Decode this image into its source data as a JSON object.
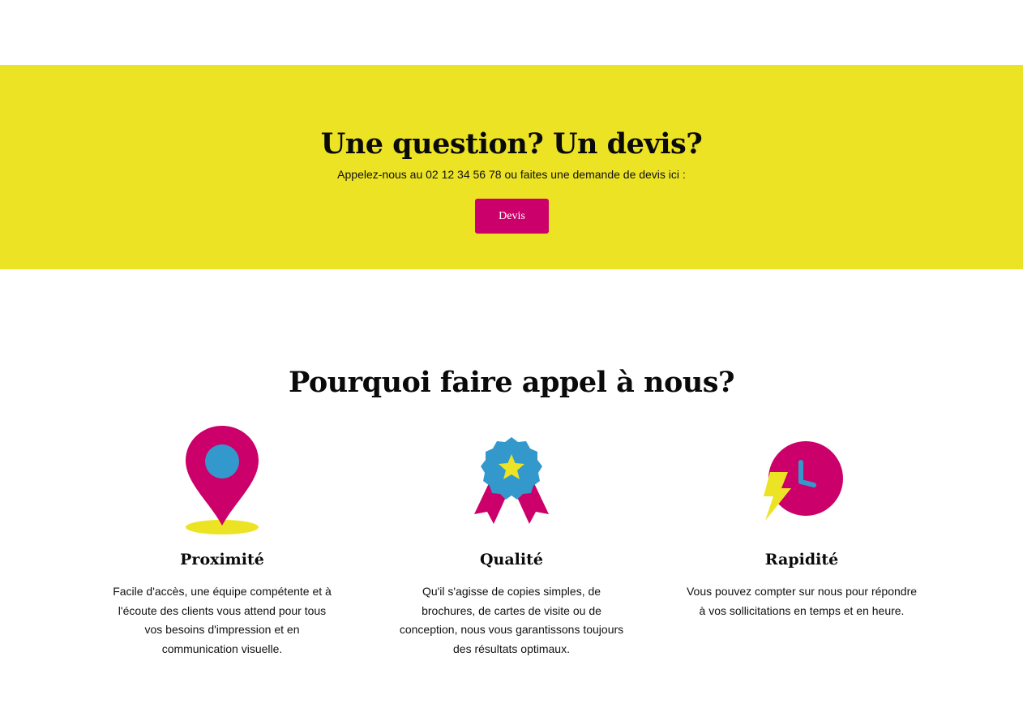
{
  "cta": {
    "title": "Une question? Un devis?",
    "text": "Appelez-nous au 02 12 34 56 78 ou faites une demande de devis ici :",
    "button_label": "Devis"
  },
  "why": {
    "title": "Pourquoi faire appel à nous?",
    "features": [
      {
        "icon": "map-pin-icon",
        "title": "Proximité",
        "text": "Facile d'accès, une équipe compétente et à l'écoute des clients vous attend pour tous vos besoins d'impression et en communication visuelle."
      },
      {
        "icon": "award-ribbon-icon",
        "title": "Qualité",
        "text": "Qu'il s'agisse de copies simples, de brochures, de cartes de visite ou de conception, nous vous garantissons toujours des résultats optimaux."
      },
      {
        "icon": "clock-lightning-icon",
        "title": "Rapidité",
        "text": "Vous pouvez compter sur nous pour répondre à vos sollicitations en temps et en heure."
      }
    ]
  },
  "colors": {
    "band_yellow": "#ede325",
    "magenta": "#cc006a",
    "blue": "#3399cc",
    "yellow_icon": "#ede325"
  }
}
